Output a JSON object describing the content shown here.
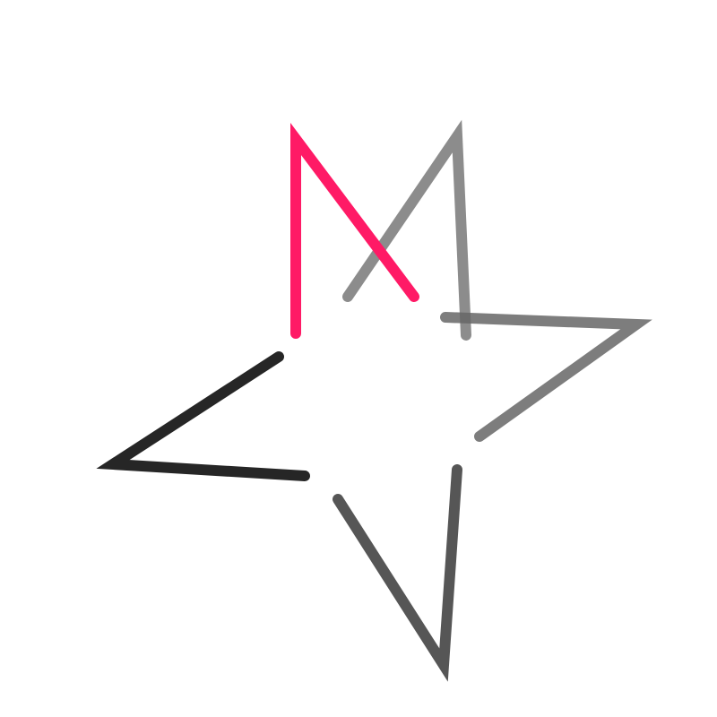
{
  "logo": {
    "name": "star-logo",
    "colors": {
      "pink": "#ff1a66",
      "gray": "#808080",
      "mid_gray": "#666666",
      "dark_gray": "#4d4d4d",
      "charcoal": "#262626",
      "background": "#ffffff"
    },
    "strokes": [
      {
        "name": "pink-m-stroke",
        "color_key": "pink",
        "opacity": 1
      },
      {
        "name": "gray-upper-right-stroke",
        "color_key": "gray",
        "opacity": 0.9
      },
      {
        "name": "gray-right-point-stroke",
        "color_key": "mid_gray",
        "opacity": 0.85
      },
      {
        "name": "gray-bottom-point-stroke",
        "color_key": "dark_gray",
        "opacity": 0.95
      },
      {
        "name": "charcoal-left-point-stroke",
        "color_key": "charcoal",
        "opacity": 1
      }
    ]
  }
}
